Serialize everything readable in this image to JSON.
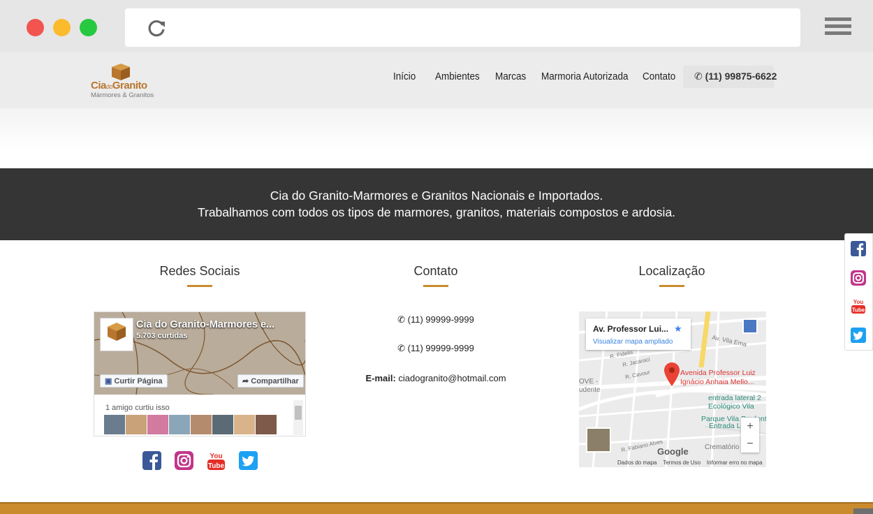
{
  "site": {
    "logo": {
      "name_a": "Cia",
      "name_do": "do",
      "name_b": "Granito",
      "tagline": "Mármores & Granitos"
    },
    "nav": [
      {
        "label": "Início"
      },
      {
        "label": "Ambientes"
      },
      {
        "label": "Marcas"
      },
      {
        "label": "Marmoria Autorizada"
      },
      {
        "label": "Contato"
      }
    ],
    "phone": "(11) 99875-6622"
  },
  "banner": {
    "line1": "Cia do Granito-Marmores e Granitos Nacionais e Importados.",
    "line2": "Trabalhamos com todos os tipos de marmores, granitos, materiais compostos e ardosia."
  },
  "sections": {
    "social": {
      "title": "Redes Sociais"
    },
    "contact": {
      "title": "Contato",
      "phone1": "(11) 99999-9999",
      "phone2": "(11) 99999-9999",
      "email_label": "E-mail:",
      "email": "ciadogranito@hotmail.com"
    },
    "location": {
      "title": "Localização"
    }
  },
  "facebook_widget": {
    "page_name": "Cia do Granito-Marmores e...",
    "likes": "5.703 curtidas",
    "like_button": "Curtir Página",
    "share_button": "Compartilhar",
    "friends_text": "1 amigo curtiu isso"
  },
  "map": {
    "card_title": "Av. Professor Lui...",
    "card_link": "Visualizar mapa ampliado",
    "pin_label_1": "Avenida Professor Luiz",
    "pin_label_2": "Ignácio Anhaia Mello...",
    "street_1": "entrada lateral 2",
    "street_2": "Ecológico Vila",
    "street_3": "Parque Vila Prudente",
    "street_4": "Entrada La",
    "street_5": "Av. Vila Ema",
    "street_6": "R. Jacaraci",
    "street_7": "R. Cavour",
    "street_8": "R. Fidelis",
    "street_9": "R. Fabiano Alves",
    "street_10": "Crematório",
    "street_11": "OVE -",
    "street_12": "udente",
    "google": "Google",
    "footer_1": "Dados do mapa",
    "footer_2": "Termos de Uso",
    "footer_3": "Informar erro no mapa"
  },
  "colors": {
    "accent": "#c98b2e",
    "banner": "#353535",
    "facebook": "#3b5998",
    "instagram": "#c1358a",
    "youtube": "#e52d27",
    "twitter": "#1da1f2"
  },
  "icons": [
    "reload-icon",
    "menu-icon",
    "phone-icon",
    "facebook-icon",
    "instagram-icon",
    "youtube-icon",
    "twitter-icon",
    "map-pin-icon",
    "street-view-icon"
  ]
}
